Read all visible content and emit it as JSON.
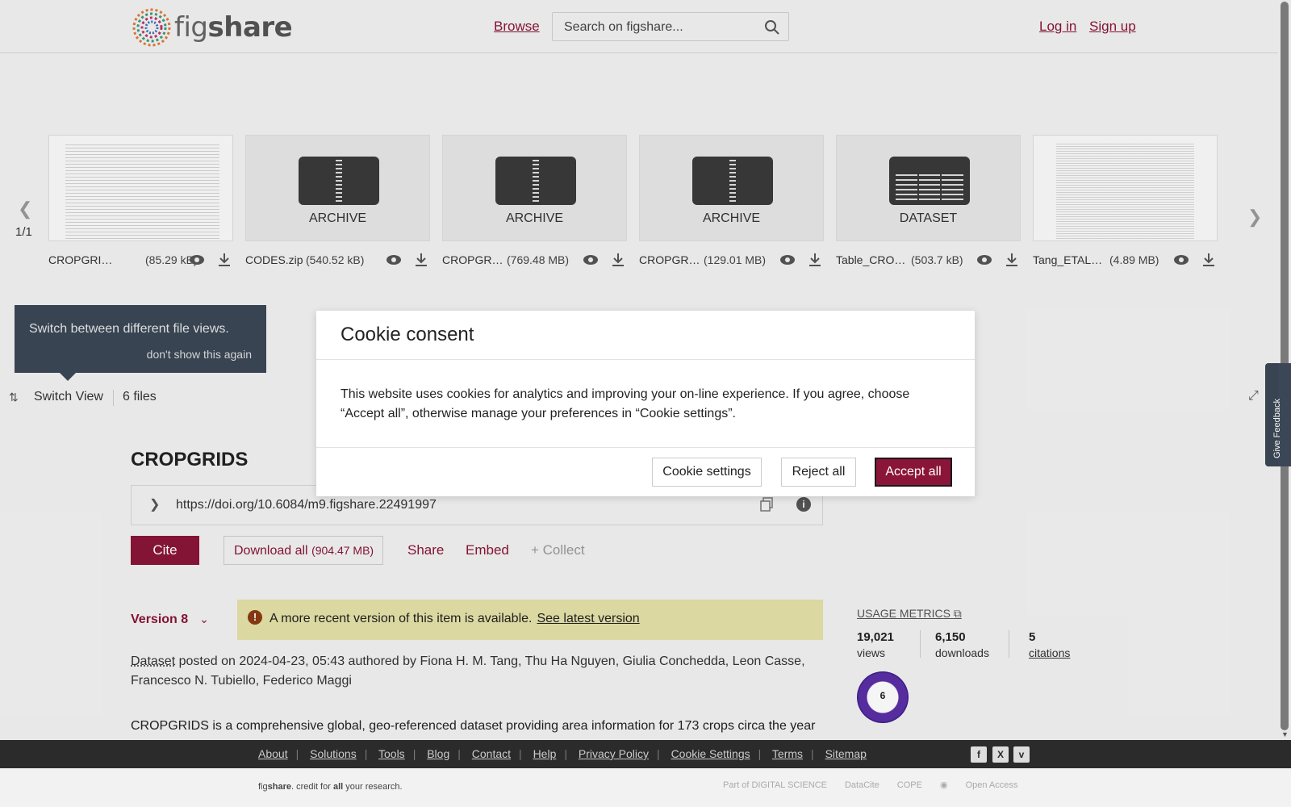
{
  "header": {
    "logo_text_fig": "fig",
    "logo_text_share": "share",
    "browse": "Browse",
    "search_placeholder": "Search on figshare...",
    "login": "Log in",
    "signup": "Sign up"
  },
  "strip": {
    "counter": "1/1",
    "files": [
      {
        "kind": "doc",
        "type_label": "",
        "name": "CROPGRI…",
        "size": "(85.29 kB)"
      },
      {
        "kind": "archive",
        "type_label": "ARCHIVE",
        "name": "CODES.zip",
        "size": "(540.52 kB)"
      },
      {
        "kind": "archive",
        "type_label": "ARCHIVE",
        "name": "CROPGR…",
        "size": "(769.48 MB)"
      },
      {
        "kind": "archive",
        "type_label": "ARCHIVE",
        "name": "CROPGR…",
        "size": "(129.01 MB)"
      },
      {
        "kind": "dataset",
        "type_label": "DATASET",
        "name": "Table_CRO…",
        "size": "(503.7 kB)"
      },
      {
        "kind": "doc",
        "type_label": "",
        "name": "Tang_ETAL…",
        "size": "(4.89 MB)"
      }
    ]
  },
  "tooltip": {
    "text": "Switch between different file views.",
    "dismiss": "don't show this again"
  },
  "viewbar": {
    "switch_view": "Switch View",
    "file_count": "6 files"
  },
  "feedback": "Give Feedback",
  "item": {
    "title": "CROPGRIDS",
    "doi": "https://doi.org/10.6084/m9.figshare.22491997",
    "cite": "Cite",
    "download_all": "Download all",
    "download_size": "(904.47 MB)",
    "share": "Share",
    "embed": "Embed",
    "collect": "+ Collect",
    "version": "Version 8",
    "alert_text": "A more recent version of this item is available.",
    "alert_link": "See latest version",
    "type": "Dataset",
    "posted_text": "posted on 2024-04-23, 05:43 authored by Fiona H. M. Tang, Thu Ha Nguyen, Giulia Conchedda, Leon Casse, Francesco N. Tubiello, Federico Maggi",
    "description": "CROPGRIDS is a comprehensive global, geo-referenced dataset providing area information for 173 crops circa the year"
  },
  "metrics": {
    "title": "USAGE METRICS",
    "views": "19,021",
    "views_label": "views",
    "downloads": "6,150",
    "downloads_label": "downloads",
    "citations": "5",
    "citations_label": "citations",
    "altmetric": "6"
  },
  "footer": {
    "links": [
      "About",
      "Solutions",
      "Tools",
      "Blog",
      "Contact",
      "Help",
      "Privacy Policy",
      "Cookie Settings",
      "Terms",
      "Sitemap"
    ],
    "credit_pre": "fig",
    "credit_brand": "share",
    "credit_mid": ". credit for ",
    "credit_all": "all",
    "credit_post": " your research.",
    "partners": [
      "Part of DIGITAL SCIENCE",
      "DataCite",
      "COPE",
      "Open Access"
    ]
  },
  "cookie": {
    "title": "Cookie consent",
    "body": "This website uses cookies for analytics and improving your on-line experience. If you agree, choose “Accept all”, otherwise manage your preferences in “Cookie settings”.",
    "settings": "Cookie settings",
    "reject": "Reject all",
    "accept": "Accept all"
  },
  "colors": {
    "brand": "#8a1538",
    "tooltip_bg": "#3b4756",
    "alert_bg": "#e4e1a8",
    "footer_bg": "#2b2b2b"
  }
}
